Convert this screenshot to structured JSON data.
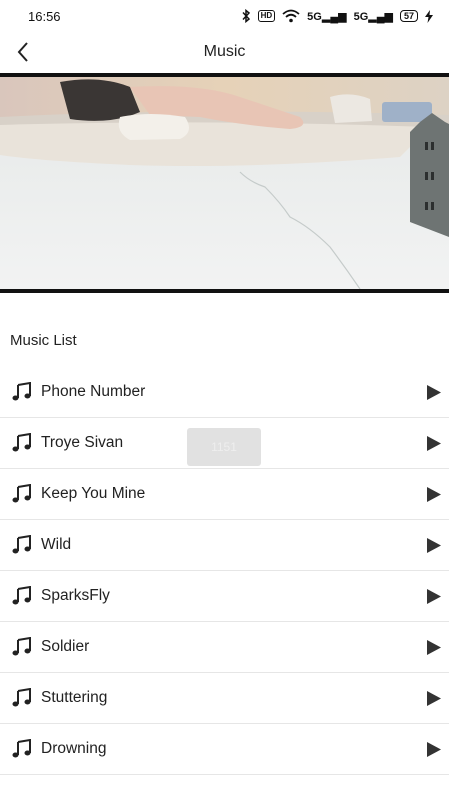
{
  "status_bar": {
    "time": "16:56",
    "hd_label": "HD",
    "network_1": "5G",
    "network_2": "5G",
    "battery": "57"
  },
  "header": {
    "title": "Music",
    "back_icon": "chevron-left-icon"
  },
  "video": {
    "description_icon": "video-preview"
  },
  "music_list": {
    "heading": "Music List",
    "item_icon": "music-note-icon",
    "play_icon": "play-icon",
    "items": [
      {
        "title": "Phone Number"
      },
      {
        "title": "Troye Sivan"
      },
      {
        "title": "Keep You Mine"
      },
      {
        "title": "Wild"
      },
      {
        "title": "SparksFly"
      },
      {
        "title": "Soldier"
      },
      {
        "title": "Stuttering"
      },
      {
        "title": "Drowning"
      }
    ]
  },
  "toast": {
    "text": "1151"
  },
  "colors": {
    "text": "#222222",
    "divider": "#e6e6e6",
    "play_icon": "#333333"
  }
}
